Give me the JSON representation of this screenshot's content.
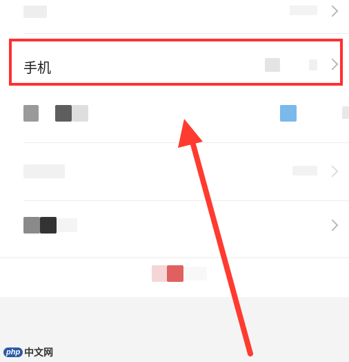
{
  "rows": {
    "phone": {
      "label": "手机"
    }
  },
  "watermark": {
    "badge": "php",
    "text": "中文网"
  },
  "colors": {
    "highlight": "#ff3030",
    "arrow": "#ff3b30",
    "accent_blue": "#7ab9ea",
    "accent_red": "#e06060"
  }
}
